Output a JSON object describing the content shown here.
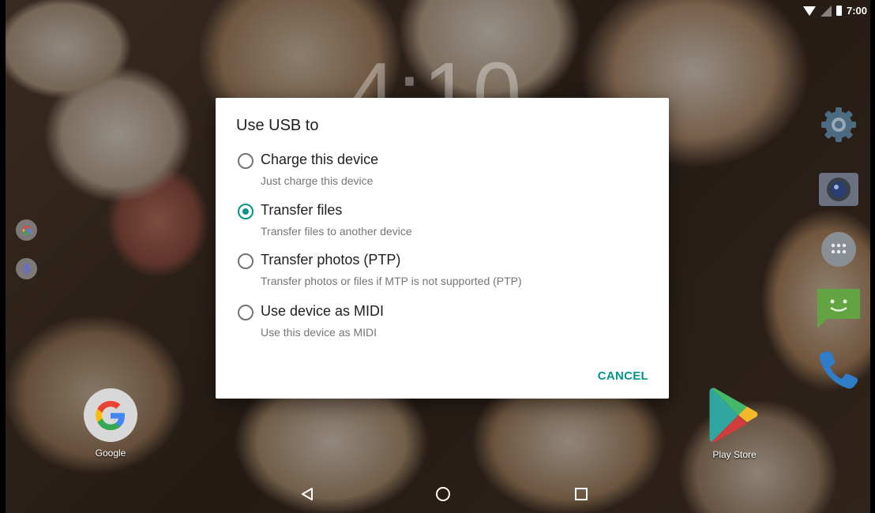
{
  "status_bar": {
    "time": "7:00"
  },
  "background_clock": "4:10",
  "dialog": {
    "title": "Use USB to",
    "options": [
      {
        "label": "Charge this device",
        "description": "Just charge this device",
        "selected": false
      },
      {
        "label": "Transfer files",
        "description": "Transfer files to another device",
        "selected": true
      },
      {
        "label": "Transfer photos (PTP)",
        "description": "Transfer photos or files if MTP is not supported (PTP)",
        "selected": false
      },
      {
        "label": "Use device as MIDI",
        "description": "Use this device as MIDI",
        "selected": false
      }
    ],
    "cancel_label": "CANCEL"
  },
  "home_apps": [
    {
      "label": "Google",
      "icon": "google-icon"
    },
    {
      "label": "Play Store",
      "icon": "play-store-icon"
    }
  ],
  "colors": {
    "accent": "#009688"
  }
}
